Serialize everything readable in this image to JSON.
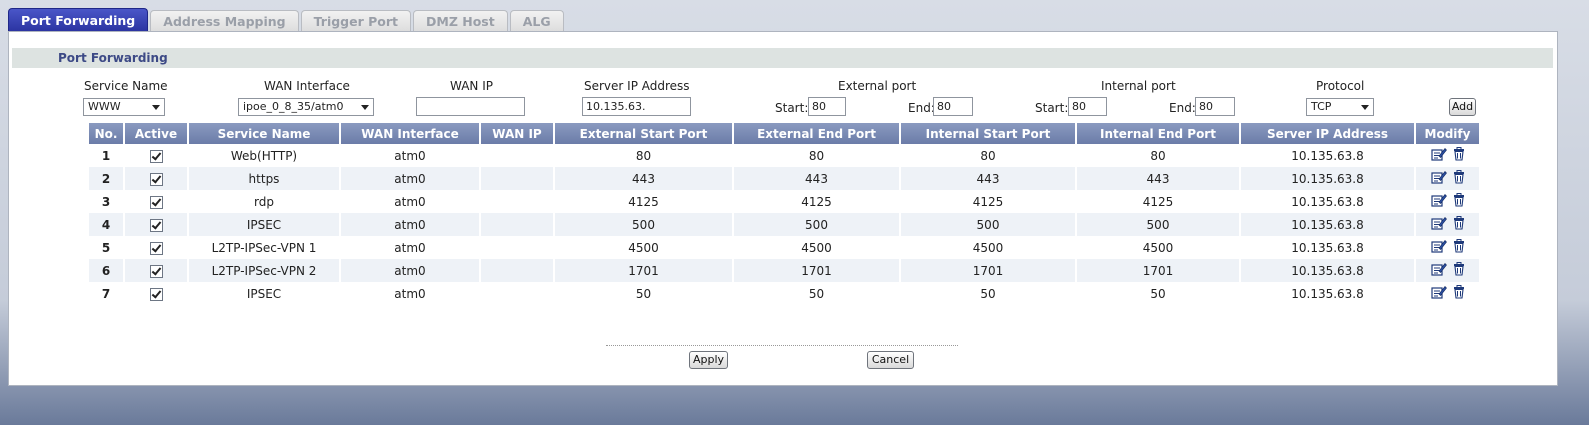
{
  "tabs": [
    "Port Forwarding",
    "Address Mapping",
    "Trigger Port",
    "DMZ Host",
    "ALG"
  ],
  "section_title": "Port Forwarding",
  "form": {
    "labels": {
      "service_name": "Service Name",
      "wan_interface": "WAN Interface",
      "wan_ip": "WAN IP",
      "server_ip": "Server IP Address",
      "external_port": "External port",
      "internal_port": "Internal port",
      "protocol": "Protocol",
      "start": "Start:",
      "end": "End:"
    },
    "service_name_value": "WWW",
    "wan_interface_value": "ipoe_0_8_35/atm0",
    "wan_ip_value": "",
    "server_ip_value": "10.135.63.",
    "ext_start": "80",
    "ext_end": "80",
    "int_start": "80",
    "int_end": "80",
    "protocol_value": "TCP",
    "add_label": "Add"
  },
  "table": {
    "headers": [
      "No.",
      "Active",
      "Service Name",
      "WAN Interface",
      "WAN IP",
      "External Start Port",
      "External End Port",
      "Internal Start Port",
      "Internal End Port",
      "Server IP Address",
      "Modify"
    ],
    "rows": [
      {
        "no": "1",
        "service": "Web(HTTP)",
        "wan": "atm0",
        "wanip": "",
        "ext_start": "80",
        "ext_end": "80",
        "int_start": "80",
        "int_end": "80",
        "server": "10.135.63.8"
      },
      {
        "no": "2",
        "service": "https",
        "wan": "atm0",
        "wanip": "",
        "ext_start": "443",
        "ext_end": "443",
        "int_start": "443",
        "int_end": "443",
        "server": "10.135.63.8"
      },
      {
        "no": "3",
        "service": "rdp",
        "wan": "atm0",
        "wanip": "",
        "ext_start": "4125",
        "ext_end": "4125",
        "int_start": "4125",
        "int_end": "4125",
        "server": "10.135.63.8"
      },
      {
        "no": "4",
        "service": "IPSEC",
        "wan": "atm0",
        "wanip": "",
        "ext_start": "500",
        "ext_end": "500",
        "int_start": "500",
        "int_end": "500",
        "server": "10.135.63.8"
      },
      {
        "no": "5",
        "service": "L2TP-IPSec-VPN 1",
        "wan": "atm0",
        "wanip": "",
        "ext_start": "4500",
        "ext_end": "4500",
        "int_start": "4500",
        "int_end": "4500",
        "server": "10.135.63.8"
      },
      {
        "no": "6",
        "service": "L2TP-IPSec-VPN 2",
        "wan": "atm0",
        "wanip": "",
        "ext_start": "1701",
        "ext_end": "1701",
        "int_start": "1701",
        "int_end": "1701",
        "server": "10.135.63.8"
      },
      {
        "no": "7",
        "service": "IPSEC",
        "wan": "atm0",
        "wanip": "",
        "ext_start": "50",
        "ext_end": "50",
        "int_start": "50",
        "int_end": "50",
        "server": "10.135.63.8"
      }
    ]
  },
  "buttons": {
    "apply": "Apply",
    "cancel": "Cancel"
  },
  "icons": {
    "edit": "edit-icon",
    "delete": "trash-icon"
  }
}
